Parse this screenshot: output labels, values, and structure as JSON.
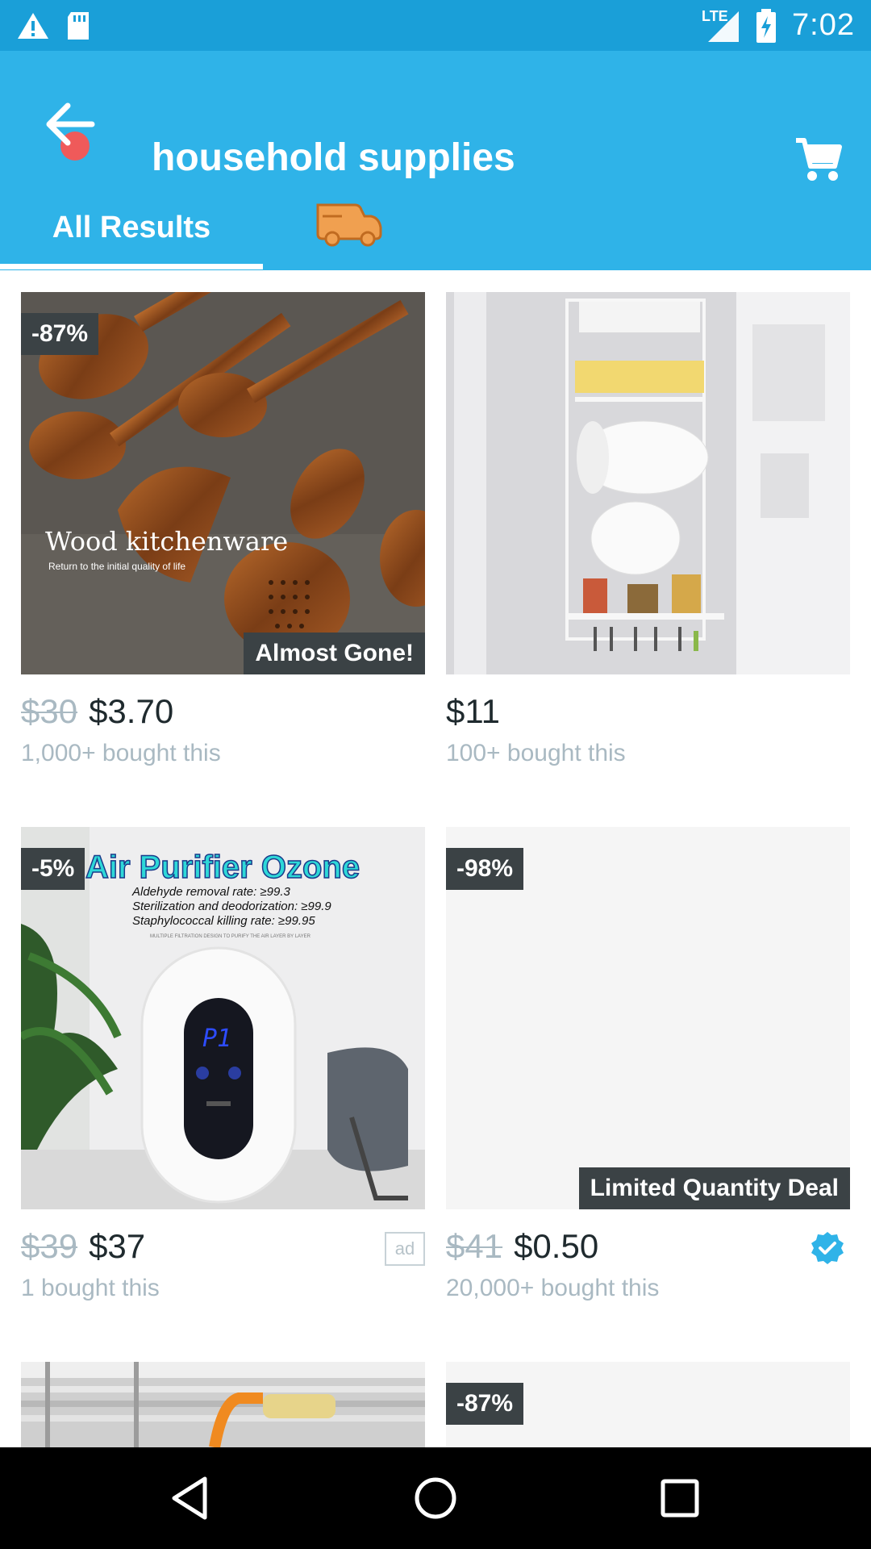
{
  "status": {
    "time": "7:02",
    "network": "LTE"
  },
  "header": {
    "title": "household supplies"
  },
  "tabs": [
    {
      "label": "All Results"
    }
  ],
  "colors": {
    "brand": "#2fb3e8",
    "status_bar": "#1a9fd8",
    "badge_bg": "#3b4245"
  },
  "products": [
    {
      "discount": "-87%",
      "banner": "Almost Gone!",
      "old_price": "$30",
      "price": "$3.70",
      "bought": "1,000+ bought this",
      "image_title": "Wood kitchenware",
      "image_subtitle": "Return to the initial quality of life"
    },
    {
      "discount": "",
      "banner": "",
      "old_price": "",
      "price": "$11",
      "bought": "100+ bought this"
    },
    {
      "discount": "-5%",
      "banner": "",
      "old_price": "$39",
      "price": "$37",
      "bought": "1 bought this",
      "ad": "ad",
      "image_title": "Air Purifier Ozone",
      "image_lines": [
        "Aldehyde removal rate: ≥99.3",
        "Sterilization and deodorization: ≥99.9",
        "Staphylococcal killing rate: ≥99.95"
      ],
      "image_small": "MULTIPLE FILTRATION DESIGN TO PURIFY THE AIR LAYER BY LAYER",
      "display": "P1"
    },
    {
      "discount": "-98%",
      "banner": "Limited Quantity Deal",
      "old_price": "$41",
      "price": "$0.50",
      "bought": "20,000+ bought this"
    },
    {
      "discount": "",
      "banner": ""
    },
    {
      "discount": "-87%",
      "banner": ""
    }
  ]
}
